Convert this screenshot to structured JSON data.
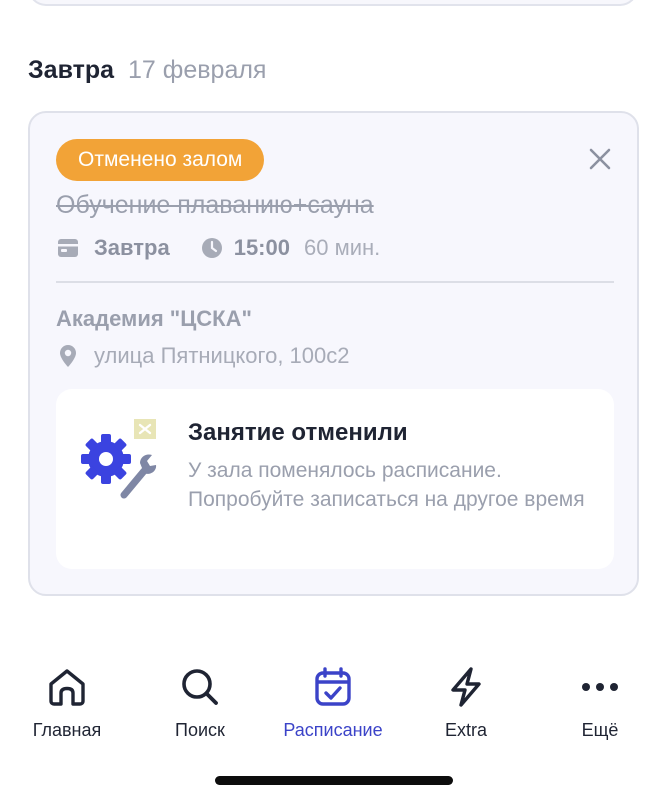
{
  "day": {
    "name": "Завтра",
    "date": "17 февраля"
  },
  "booking": {
    "status_badge": "Отменено залом",
    "title": "Обучение плаванию+сауна",
    "day": "Завтра",
    "time": "15:00",
    "duration": "60 мин.",
    "gym": "Академия \"ЦСКА\"",
    "address": "улица Пятницкого, 100с2",
    "notice": {
      "title": "Занятие отменили",
      "text": "У зала поменялось расписание. Попробуйте записаться на другое время"
    }
  },
  "nav": {
    "items": [
      {
        "label": "Главная",
        "icon": "home-icon"
      },
      {
        "label": "Поиск",
        "icon": "search-icon"
      },
      {
        "label": "Расписание",
        "icon": "calendar-icon",
        "active": true
      },
      {
        "label": "Extra",
        "icon": "lightning-icon"
      },
      {
        "label": "Ещё",
        "icon": "more-icon"
      }
    ]
  },
  "colors": {
    "badge": "#f2a337",
    "accent": "#3b43c8",
    "text": "#1f2433",
    "muted": "#9a9fad"
  }
}
